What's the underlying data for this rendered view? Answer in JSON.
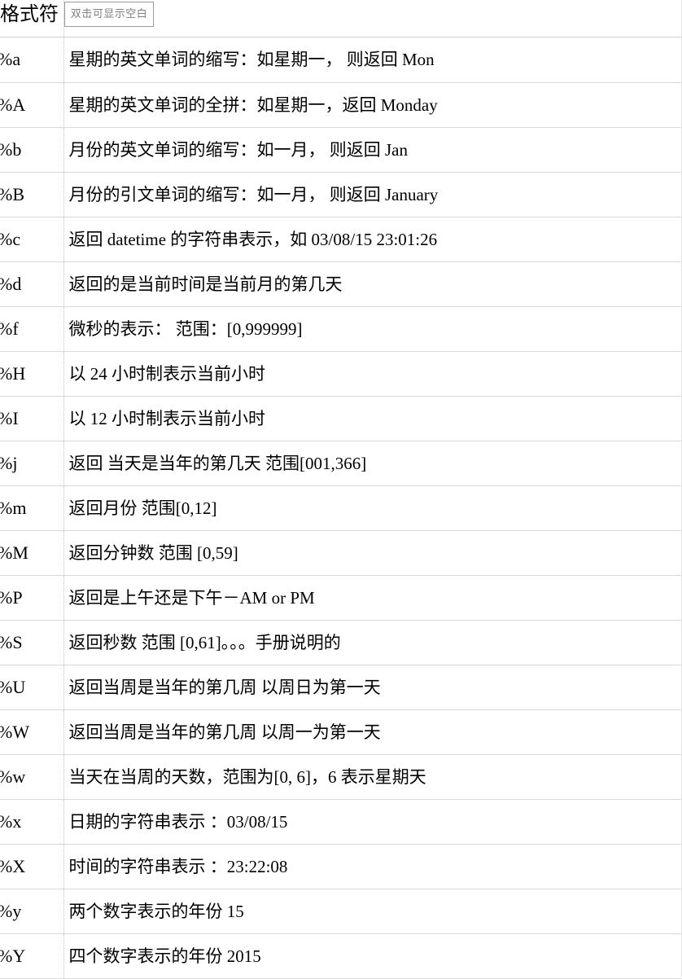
{
  "table": {
    "header": {
      "code_column_label": "格式符",
      "toggle_button_label": "双击可显示空白"
    },
    "rows": [
      {
        "code": "%a",
        "desc": "星期的英文单词的缩写：如星期一， 则返回 Mon"
      },
      {
        "code": "%A",
        "desc": "星期的英文单词的全拼：如星期一，返回 Monday"
      },
      {
        "code": "%b",
        "desc": "月份的英文单词的缩写：如一月， 则返回 Jan"
      },
      {
        "code": "%B",
        "desc": "月份的引文单词的缩写：如一月， 则返回 January"
      },
      {
        "code": "%c",
        "desc": "返回 datetime 的字符串表示，如 03/08/15 23:01:26"
      },
      {
        "code": "%d",
        "desc": "返回的是当前时间是当前月的第几天"
      },
      {
        "code": "%f",
        "desc": "微秒的表示： 范围：[0,999999]"
      },
      {
        "code": "%H",
        "desc": "以 24 小时制表示当前小时"
      },
      {
        "code": "%I",
        "desc": "以 12 小时制表示当前小时"
      },
      {
        "code": "%j",
        "desc": "返回 当天是当年的第几天 范围[001,366]"
      },
      {
        "code": "%m",
        "desc": "返回月份 范围[0,12]"
      },
      {
        "code": "%M",
        "desc": "返回分钟数 范围 [0,59]"
      },
      {
        "code": "%P",
        "desc": "返回是上午还是下午－AM or PM"
      },
      {
        "code": "%S",
        "desc": "返回秒数 范围 [0,61]。。。手册说明的"
      },
      {
        "code": "%U",
        "desc": "返回当周是当年的第几周 以周日为第一天"
      },
      {
        "code": "%W",
        "desc": "返回当周是当年的第几周 以周一为第一天"
      },
      {
        "code": "%w",
        "desc": "当天在当周的天数，范围为[0, 6]，6 表示星期天"
      },
      {
        "code": "%x",
        "desc": "日期的字符串表示 ：03/08/15"
      },
      {
        "code": "%X",
        "desc": "时间的字符串表示 ：23:22:08"
      },
      {
        "code": "%y",
        "desc": "两个数字表示的年份 15"
      },
      {
        "code": "%Y",
        "desc": "四个数字表示的年份 2015"
      }
    ]
  }
}
